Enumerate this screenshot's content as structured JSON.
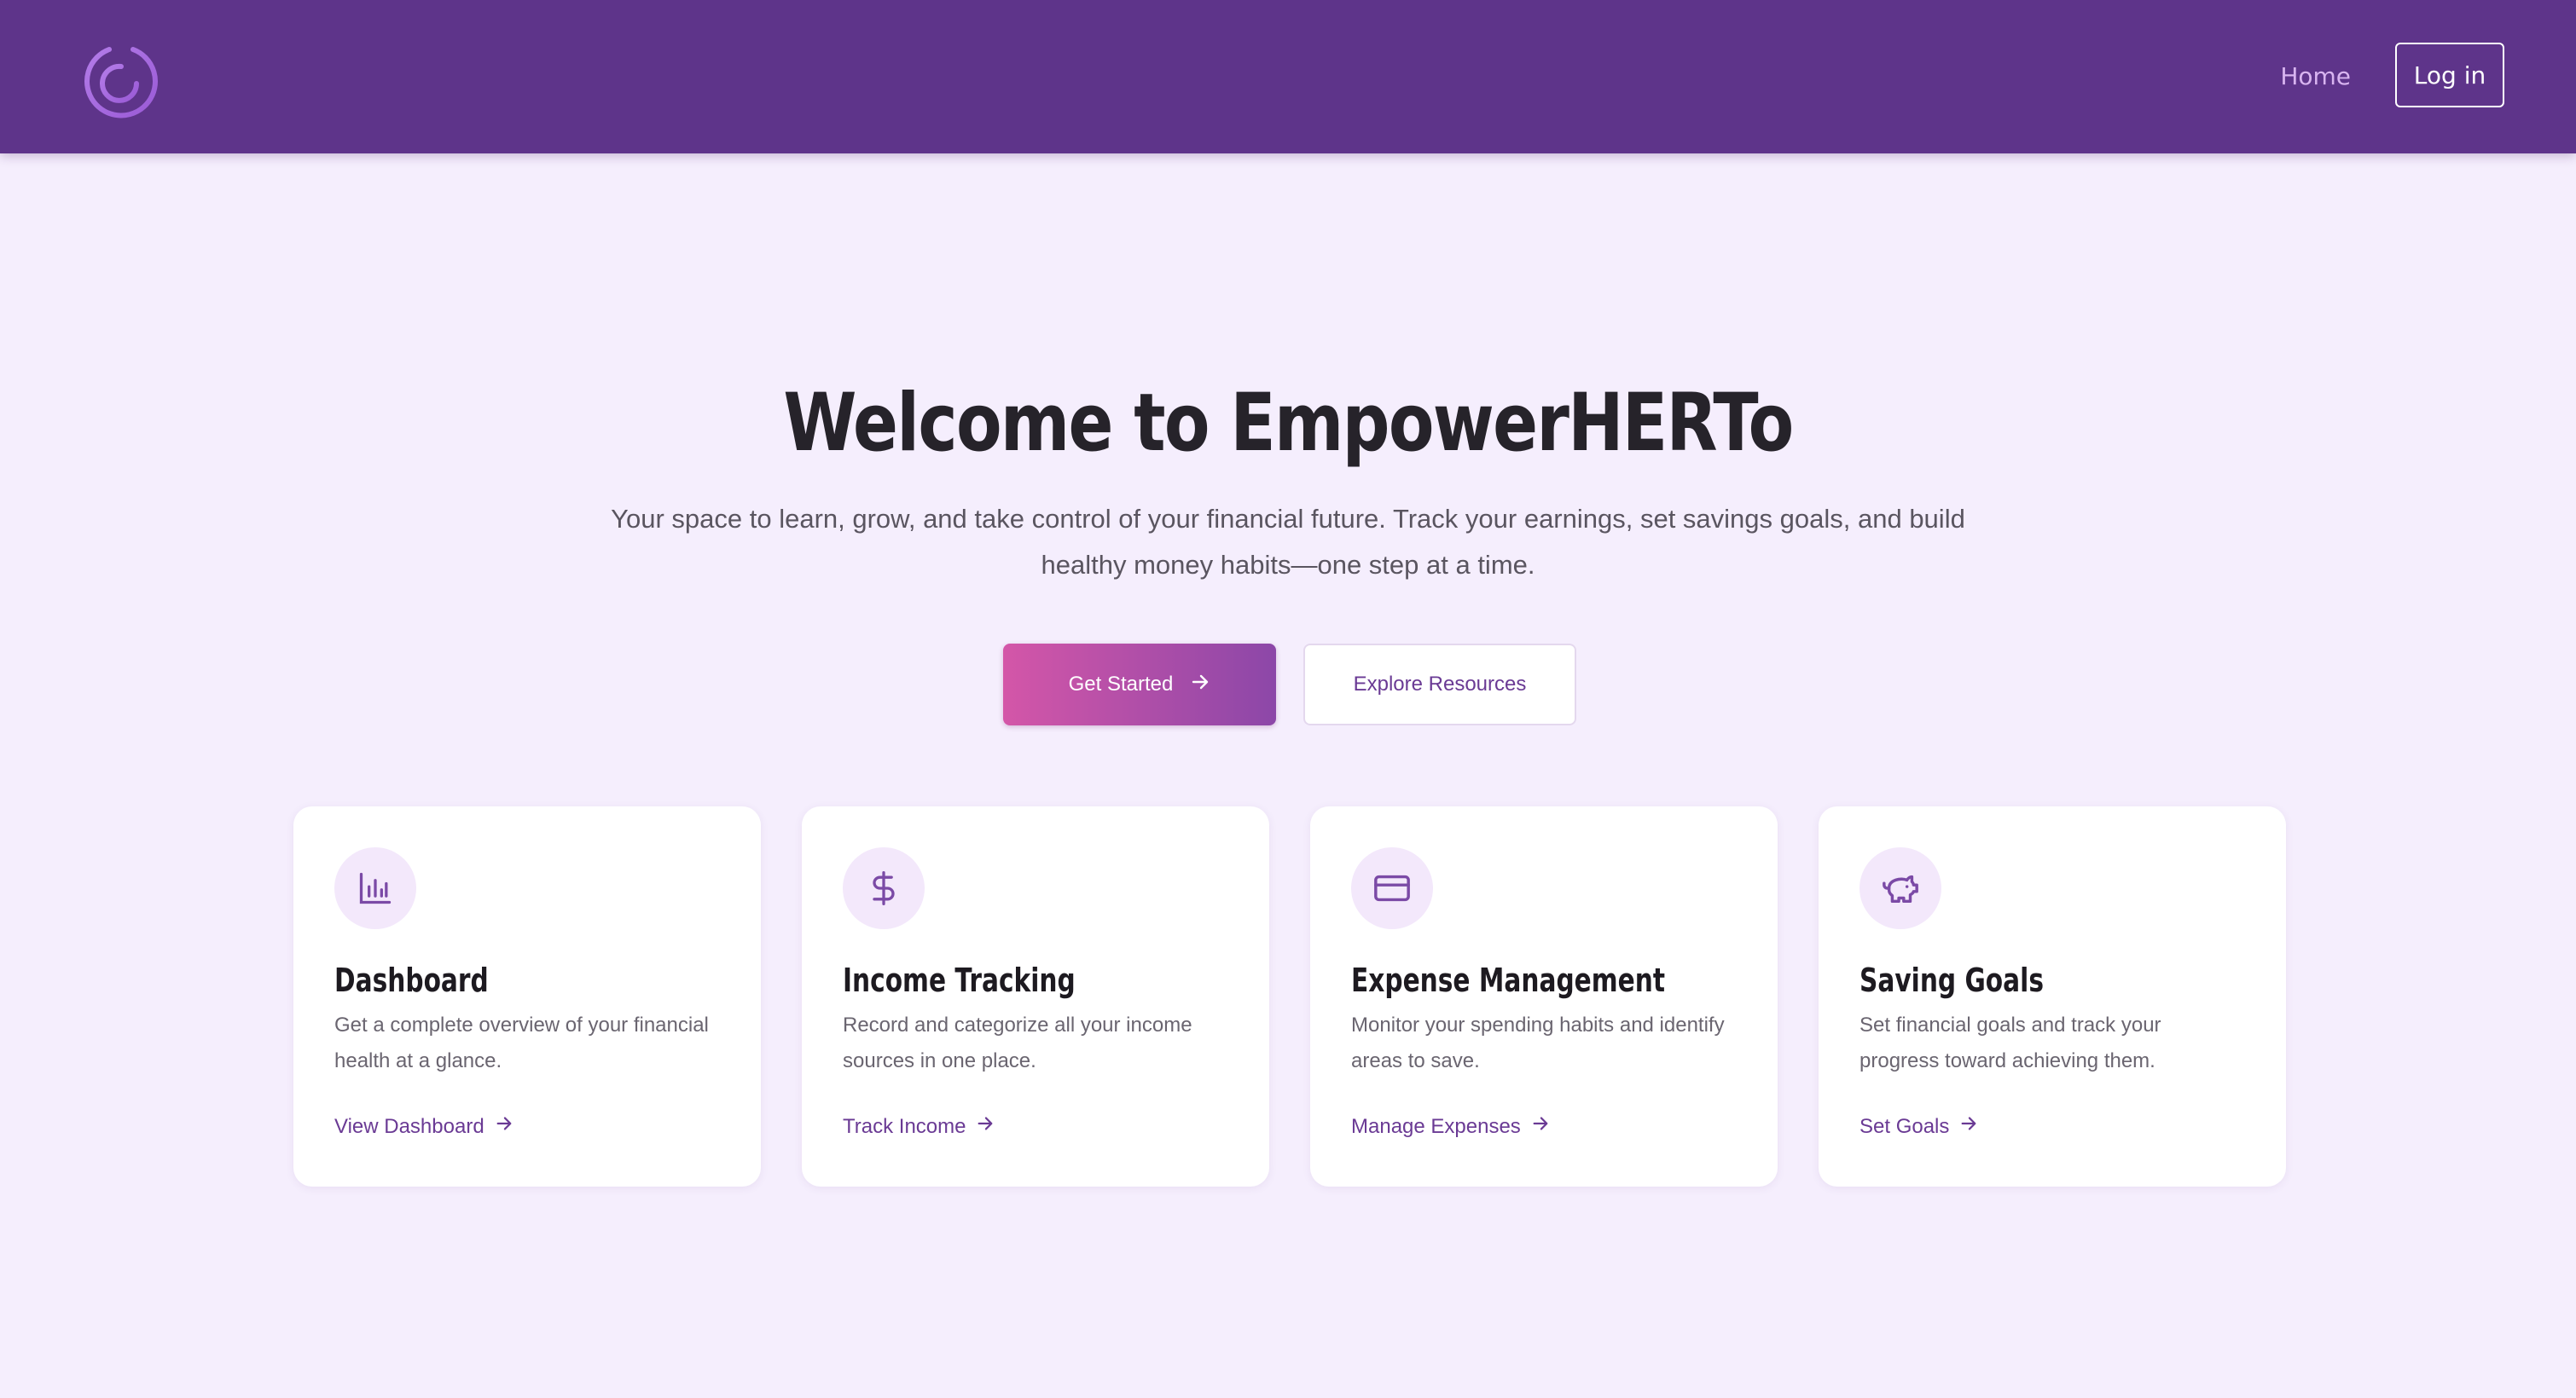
{
  "header": {
    "nav_home": "Home",
    "login_label": "Log in"
  },
  "hero": {
    "title": "Welcome to EmpowerHERTo",
    "subtitle": "Your space to learn, grow, and take control of your financial future. Track your earnings, set savings goals, and build healthy money habits—one step at a time.",
    "primary_button": "Get Started",
    "secondary_button": "Explore Resources"
  },
  "cards": [
    {
      "icon": "bar-chart-icon",
      "title": "Dashboard",
      "description": "Get a complete overview of your financial health at a glance.",
      "link": "View Dashboard"
    },
    {
      "icon": "dollar-icon",
      "title": "Income Tracking",
      "description": "Record and categorize all your income sources in one place.",
      "link": "Track Income"
    },
    {
      "icon": "credit-card-icon",
      "title": "Expense Management",
      "description": "Monitor your spending habits and identify areas to save.",
      "link": "Manage Expenses"
    },
    {
      "icon": "piggy-bank-icon",
      "title": "Saving Goals",
      "description": "Set financial goals and track your progress toward achieving them.",
      "link": "Set Goals"
    }
  ],
  "colors": {
    "header_bg": "#5e348a",
    "page_bg": "#f5eefd",
    "accent": "#6a3a94",
    "gradient_start": "#d456a8",
    "gradient_end": "#8c47a8"
  }
}
